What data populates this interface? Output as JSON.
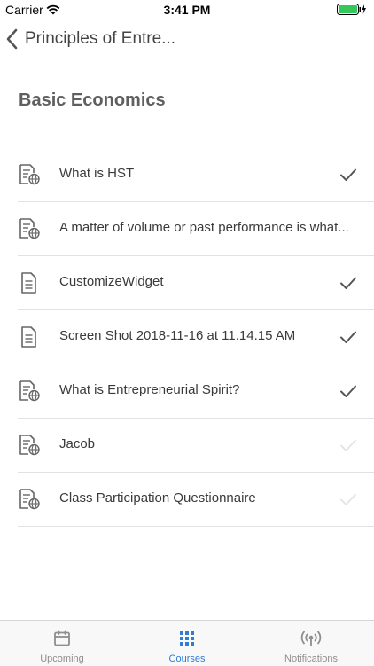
{
  "status_bar": {
    "carrier": "Carrier",
    "time": "3:41 PM"
  },
  "nav": {
    "title": "Principles of Entre..."
  },
  "section": {
    "title": "Basic Economics"
  },
  "items": [
    {
      "title": "What is HST",
      "icon": "web-document-icon",
      "completed": true
    },
    {
      "title": "A matter of volume or past performance is what...",
      "icon": "web-document-icon",
      "completed": false,
      "check_shown": false
    },
    {
      "title": "CustomizeWidget",
      "icon": "document-icon",
      "completed": true
    },
    {
      "title": "Screen Shot 2018-11-16 at 11.14.15 AM",
      "icon": "document-icon",
      "completed": true
    },
    {
      "title": "What is Entrepreneurial Spirit?",
      "icon": "web-document-icon",
      "completed": true
    },
    {
      "title": "Jacob",
      "icon": "web-document-icon",
      "completed": false
    },
    {
      "title": "Class Participation Questionnaire",
      "icon": "web-document-icon",
      "completed": false
    }
  ],
  "tabs": [
    {
      "label": "Upcoming",
      "icon": "calendar-icon",
      "active": false
    },
    {
      "label": "Courses",
      "icon": "grid-icon",
      "active": true
    },
    {
      "label": "Notifications",
      "icon": "broadcast-icon",
      "active": false
    }
  ],
  "colors": {
    "accent": "#2f7bd6",
    "check_done": "#555555",
    "check_pending": "#e6e6e6"
  }
}
